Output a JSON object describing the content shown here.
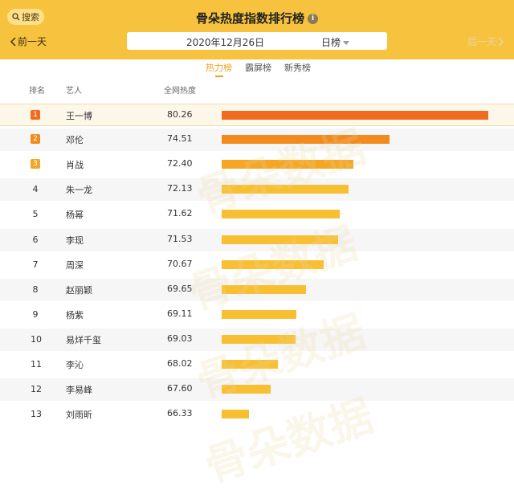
{
  "header": {
    "search_label": "搜索",
    "title": "骨朵热度指数排行榜",
    "info_icon": "i",
    "prev_label": "前一天",
    "next_label": "后一天",
    "date": "2020年12月26日",
    "period": "日榜"
  },
  "tabs": [
    {
      "label": "热力榜",
      "active": true
    },
    {
      "label": "霸屏榜",
      "active": false
    },
    {
      "label": "新秀榜",
      "active": false
    }
  ],
  "columns": {
    "rank": "排名",
    "artist": "艺人",
    "score": "全网热度"
  },
  "watermark": "骨朵数据",
  "colors": {
    "header_bg": "#f7c33e",
    "bar_1": "#f26a1e",
    "bar_2": "#f28a1e",
    "bar_3": "#f5a623",
    "bar_default": "#f9bf32",
    "active_tab": "#f0a21a"
  },
  "chart_data": {
    "type": "bar",
    "orientation": "horizontal",
    "title": "骨朵热度指数排行榜",
    "categories": [
      "王一博",
      "邓伦",
      "肖战",
      "朱一龙",
      "杨幂",
      "李现",
      "周深",
      "赵丽颖",
      "杨紫",
      "易烊千玺",
      "李沁",
      "李易峰",
      "刘雨昕"
    ],
    "ranks": [
      "1",
      "2",
      "3",
      "4",
      "5",
      "6",
      "7",
      "8",
      "9",
      "10",
      "11",
      "12",
      "13"
    ],
    "values": [
      80.26,
      74.51,
      72.4,
      72.13,
      71.62,
      71.53,
      70.67,
      69.65,
      69.11,
      69.03,
      68.02,
      67.6,
      66.33
    ],
    "value_labels": [
      "80.26",
      "74.51",
      "72.40",
      "72.13",
      "71.62",
      "71.53",
      "70.67",
      "69.65",
      "69.11",
      "69.03",
      "68.02",
      "67.60",
      "66.33"
    ],
    "bar_scale": [
      66.33,
      80.26
    ],
    "xlabel": "",
    "ylabel": ""
  }
}
